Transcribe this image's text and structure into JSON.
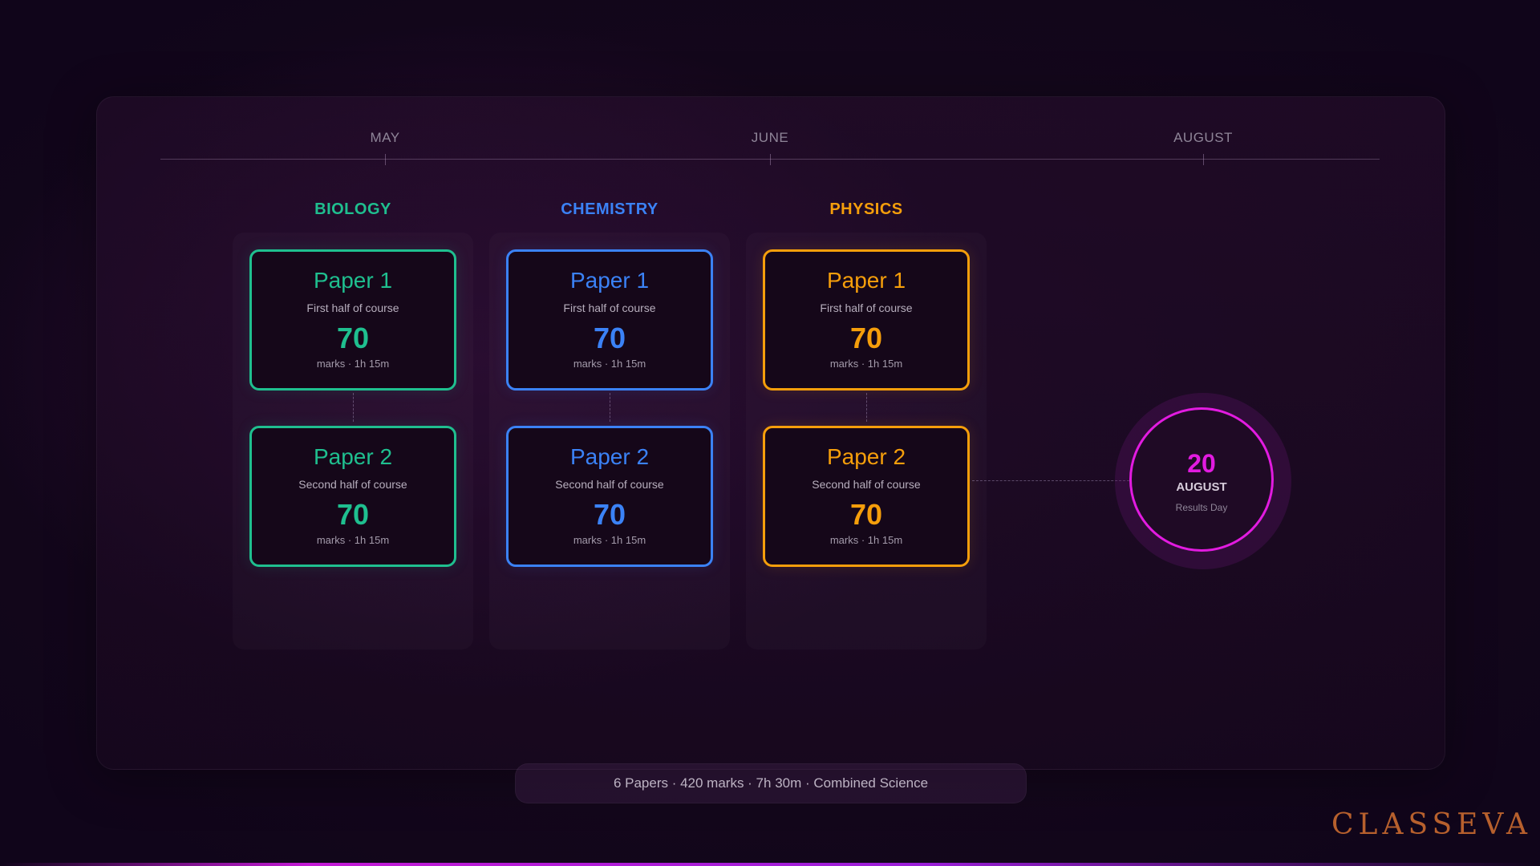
{
  "timeline": {
    "months": [
      "MAY",
      "JUNE",
      "AUGUST"
    ]
  },
  "subjects": [
    {
      "name": "BIOLOGY",
      "color": "#1fbf8f",
      "papers": [
        {
          "title": "Paper 1",
          "desc": "First half of course",
          "marks": "70",
          "meta": "marks · 1h 15m"
        },
        {
          "title": "Paper 2",
          "desc": "Second half of course",
          "marks": "70",
          "meta": "marks · 1h 15m"
        }
      ]
    },
    {
      "name": "CHEMISTRY",
      "color": "#3b82f6",
      "papers": [
        {
          "title": "Paper 1",
          "desc": "First half of course",
          "marks": "70",
          "meta": "marks · 1h 15m"
        },
        {
          "title": "Paper 2",
          "desc": "Second half of course",
          "marks": "70",
          "meta": "marks · 1h 15m"
        }
      ]
    },
    {
      "name": "PHYSICS",
      "color": "#f59e0b",
      "papers": [
        {
          "title": "Paper 1",
          "desc": "First half of course",
          "marks": "70",
          "meta": "marks · 1h 15m"
        },
        {
          "title": "Paper 2",
          "desc": "Second half of course",
          "marks": "70",
          "meta": "marks · 1h 15m"
        }
      ]
    }
  ],
  "results": {
    "day": "20",
    "month": "AUGUST",
    "label": "Results Day",
    "color": "#e21be0"
  },
  "summary": "6 Papers · 420 marks · 7h 30m · Combined Science",
  "logo": "CLASSEVA"
}
